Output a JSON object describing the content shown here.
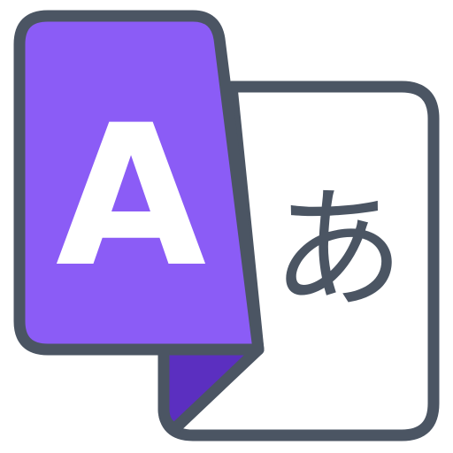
{
  "icon": {
    "name": "translate-icon",
    "source_letter": "A",
    "target_letter": "あ",
    "colors": {
      "outline": "#4b5563",
      "source_fill": "#8b5cf6",
      "fold_fill": "#5b2fc0",
      "target_fill": "#ffffff",
      "source_text": "#ffffff",
      "target_text": "#4b5563"
    }
  }
}
